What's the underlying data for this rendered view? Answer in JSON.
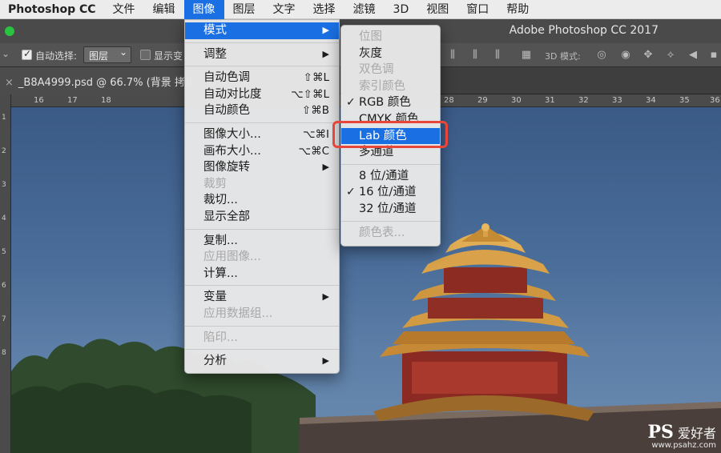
{
  "menubar": {
    "app": "Photoshop CC",
    "items": [
      "文件",
      "编辑",
      "图像",
      "图层",
      "文字",
      "选择",
      "滤镜",
      "3D",
      "视图",
      "窗口",
      "帮助"
    ],
    "active_index": 2
  },
  "window": {
    "title": "Adobe Photoshop CC 2017"
  },
  "options_bar": {
    "auto_select_label": "自动选择:",
    "auto_select_value": "图层",
    "show_transform_label": "显示变",
    "mode_3d_label": "3D 模式:"
  },
  "document_tab": {
    "close": "×",
    "title": "_B8A4999.psd @ 66.7% (背景 拷贝"
  },
  "rulers": {
    "h_ticks": [
      "16",
      "17",
      "18",
      "28",
      "29",
      "30",
      "31",
      "32",
      "33",
      "34",
      "35",
      "36"
    ],
    "v_ticks": [
      "1",
      "2",
      "3",
      "4",
      "5",
      "6",
      "7",
      "8"
    ]
  },
  "image_menu": {
    "items": [
      {
        "label": "模式",
        "submenu": true,
        "highlight": true
      },
      {
        "sep": true
      },
      {
        "label": "调整",
        "submenu": true
      },
      {
        "sep": true
      },
      {
        "label": "自动色调",
        "shortcut": "⇧⌘L"
      },
      {
        "label": "自动对比度",
        "shortcut": "⌥⇧⌘L"
      },
      {
        "label": "自动颜色",
        "shortcut": "⇧⌘B"
      },
      {
        "sep": true
      },
      {
        "label": "图像大小...",
        "shortcut": "⌥⌘I"
      },
      {
        "label": "画布大小...",
        "shortcut": "⌥⌘C"
      },
      {
        "label": "图像旋转",
        "submenu": true
      },
      {
        "label": "裁剪",
        "disabled": true
      },
      {
        "label": "裁切..."
      },
      {
        "label": "显示全部"
      },
      {
        "sep": true
      },
      {
        "label": "复制..."
      },
      {
        "label": "应用图像...",
        "disabled": true
      },
      {
        "label": "计算..."
      },
      {
        "sep": true
      },
      {
        "label": "变量",
        "submenu": true
      },
      {
        "label": "应用数据组...",
        "disabled": true
      },
      {
        "sep": true
      },
      {
        "label": "陷印...",
        "disabled": true
      },
      {
        "sep": true
      },
      {
        "label": "分析",
        "submenu": true
      }
    ]
  },
  "mode_menu": {
    "items": [
      {
        "label": "位图",
        "disabled": true
      },
      {
        "label": "灰度"
      },
      {
        "label": "双色调",
        "disabled": true
      },
      {
        "label": "索引颜色",
        "disabled": true
      },
      {
        "label": "RGB 颜色",
        "checked": true
      },
      {
        "label": "CMYK 颜色"
      },
      {
        "label": "Lab 颜色",
        "highlight": true
      },
      {
        "label": "多通道"
      },
      {
        "sep": true
      },
      {
        "label": "8 位/通道"
      },
      {
        "label": "16 位/通道",
        "checked": true
      },
      {
        "label": "32 位/通道"
      },
      {
        "sep": true
      },
      {
        "label": "颜色表...",
        "disabled": true
      }
    ]
  },
  "watermark": {
    "ps": "PS",
    "cn": "爱好者",
    "url": "www.psahz.com"
  },
  "colors": {
    "menu_highlight": "#1a6fe3",
    "annotation_box": "#e8463a"
  }
}
